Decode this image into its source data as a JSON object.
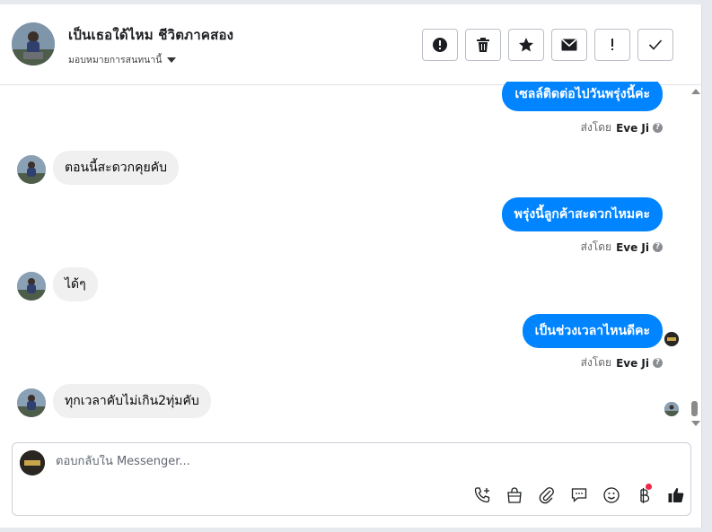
{
  "header": {
    "title": "เป็นเธอใด้ไหม ชีวิตภาคสอง",
    "subtitle": "มอบหมายการสนทนานี้"
  },
  "messages": [
    {
      "direction": "out",
      "text": "เซลล์ติดต่อไปวันพรุ่งนี้ค่ะ",
      "sent_by_label": "ส่งโดย",
      "sent_by_name": "Eve Ji"
    },
    {
      "direction": "in",
      "text": "ตอนนี้สะดวกคุยคับ"
    },
    {
      "direction": "out",
      "text": "พรุ่งนี้ลูกค้าสะดวกไหมคะ",
      "sent_by_label": "ส่งโดย",
      "sent_by_name": "Eve Ji"
    },
    {
      "direction": "in",
      "text": "ได้ๆ"
    },
    {
      "direction": "out",
      "text": "เป็นช่วงเวลาไหนดีคะ",
      "sent_by_label": "ส่งโดย",
      "sent_by_name": "Eve Ji"
    },
    {
      "direction": "in",
      "text": "ทุกเวลาคับไม่เกิน2ทุ่มคับ"
    }
  ],
  "composer": {
    "placeholder": "ตอบกลับใน Messenger..."
  },
  "colors": {
    "accent": "#0084ff",
    "incoming_bubble": "#f0f0f0",
    "notification_dot": "#f02849"
  },
  "icons": {
    "actions": [
      "alert-circle-icon",
      "trash-icon",
      "star-icon",
      "mail-icon",
      "exclamation-icon",
      "checkmark-icon"
    ],
    "composer_tools": [
      "call-add-icon",
      "shopping-bag-icon",
      "paperclip-icon",
      "comment-icon",
      "smiley-icon",
      "baht-icon",
      "thumbs-up-icon"
    ]
  }
}
